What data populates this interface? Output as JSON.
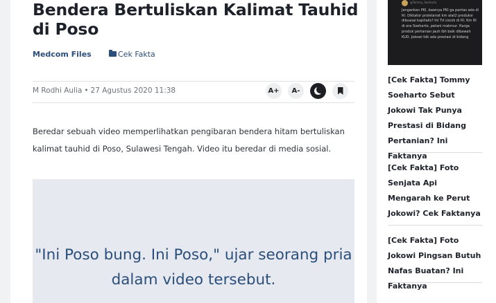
{
  "article": {
    "title": "Bendera Bertuliskan Kalimat Tauhid di Poso",
    "source": "Medcom Files",
    "category": "Cek Fakta",
    "author": "M Rodhi Aulia",
    "separator": "•",
    "date": "27 Agustus 2020 11:38",
    "paragraph": "Beredar sebuah video memperlihatkan pengibaran bendera hitam bertuliskan kalimat tauhid di Poso, Sulawesi Tengah. Video itu beredar di media sosial.",
    "quote": "\"Ini Poso bung. Ini Poso,\" ujar seorang pria dalam video tersebut."
  },
  "toolbar": {
    "font_increase": "A+",
    "font_decrease": "A-"
  },
  "sidebar": {
    "thumbnail": {
      "handle": "@Tommy_Soeharto",
      "text": "Jangankan PKI, bawnya PKI ga pantas ada di RI. Diktator proletariat km alat2 produksi dikuasai kapitalis? Ini Td cocok di RI. Km RI di era Soeharto, petani makmur. Harga produk pertanian jauh lbh baik dibawah KUD. Jokowi tdk ada prestasi di bidang"
    },
    "items": [
      {
        "label": "[Cek Fakta] Tommy Soeharto Sebut Jokowi Tak Punya Prestasi di Bidang Pertanian? Ini Faktanya"
      },
      {
        "label": "[Cek Fakta] Foto Senjata Api Mengarah ke Perut Jokowi? Cek Faktanya"
      },
      {
        "label": "[Cek Fakta] Foto Jokowi Pingsan Butuh Nafas Buatan? Ini Faktanya"
      }
    ]
  }
}
